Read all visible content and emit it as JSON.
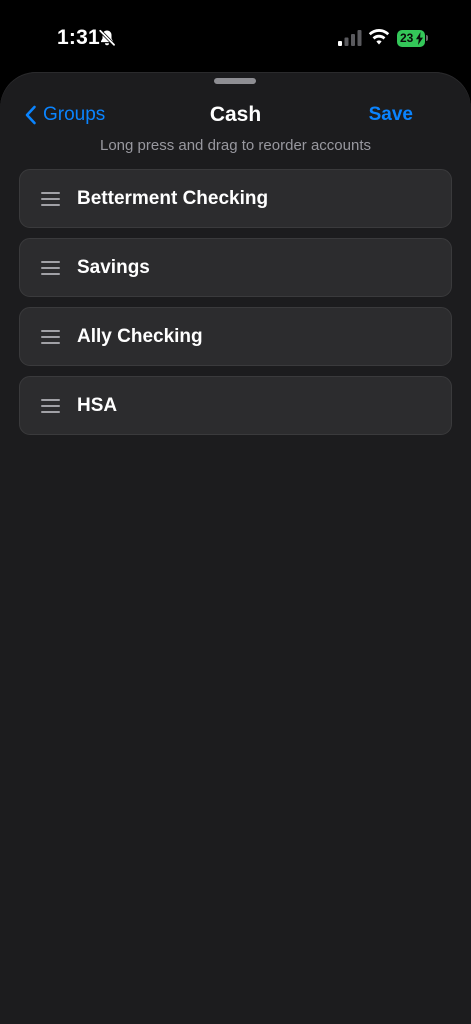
{
  "status_bar": {
    "time": "1:31",
    "battery_level": "23",
    "battery_color": "#34c759",
    "icons": [
      "bell-off-icon",
      "signal-icon",
      "wifi-icon",
      "battery-charging-icon"
    ]
  },
  "nav": {
    "back_label": "Groups",
    "title": "Cash",
    "save_label": "Save",
    "accent_color": "#0a84ff"
  },
  "hint": "Long press and drag to reorder accounts",
  "accounts": [
    {
      "name": "Betterment Checking",
      "icon": "drag-handle-icon"
    },
    {
      "name": "Savings",
      "icon": "drag-handle-icon"
    },
    {
      "name": "Ally Checking",
      "icon": "drag-handle-icon"
    },
    {
      "name": "HSA",
      "icon": "drag-handle-icon"
    }
  ]
}
